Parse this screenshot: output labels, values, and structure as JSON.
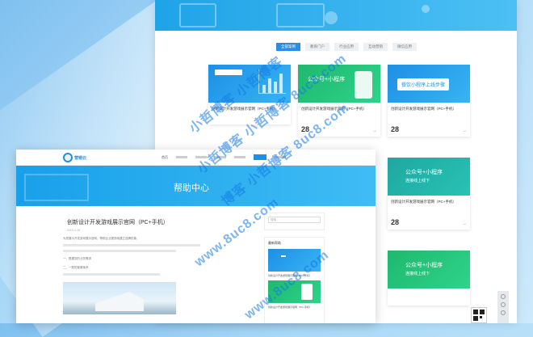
{
  "back_window": {
    "filter_tabs": [
      "全部案例",
      "教育门户",
      "行业应用",
      "互动营销",
      "微信应用"
    ],
    "cards": [
      {
        "thumb_label": "",
        "title": "创新设计开发游戏展示官网（PC+手机）",
        "desc": "",
        "day": "",
        "month": ""
      },
      {
        "thumb_label": "公众号+小程序",
        "thumb_sub": "",
        "title": "创新设计开发游戏展示官网（PC+手机）",
        "desc": "",
        "day": "28",
        "month": ""
      },
      {
        "thumb_label": "餐饮小程序上线步骤",
        "title": "创新设计开发游戏展示官网（PC+手机）",
        "desc": "",
        "day": "28",
        "month": ""
      },
      {
        "thumb_label": "公众号+小程序",
        "thumb_sub": "连接线上线下",
        "title": "创新设计开发游戏展示官网（PC+手机）",
        "desc": "",
        "day": "28",
        "month": ""
      },
      {
        "thumb_label": "公众号+小程序",
        "thumb_sub": "连接线上线下",
        "title": "",
        "desc": "",
        "day": "",
        "month": ""
      }
    ]
  },
  "front_window": {
    "logo_text": "营销云",
    "nav": [
      "首页",
      "",
      "",
      "",
      "",
      "帮助中心",
      ""
    ],
    "banner_title": "帮助中心",
    "article": {
      "title": "创新设计开发游戏展示官网（PC+手机）",
      "date": "2019-4-28",
      "lines": [
        "为您展示开发游戏展示官网，帮助企业更快地建立品牌形象。",
        "",
        "一、根据您的业务需求",
        "二、一般的客服版本"
      ]
    },
    "sidebar": {
      "search_placeholder": "搜索",
      "latest_title": "最新帮助",
      "items": [
        "创新设计开发游戏展示官网（PC+手机）",
        "创新设计开发游戏展示官网（PC+手机）"
      ]
    }
  },
  "watermark": {
    "lines": [
      "小哲博客 小哲博客",
      "小哲博客 小哲博客 8uc8.com",
      "博客 小哲博客 8uc8.com",
      "www.8uc8.com",
      "www.8uc8.com"
    ]
  }
}
